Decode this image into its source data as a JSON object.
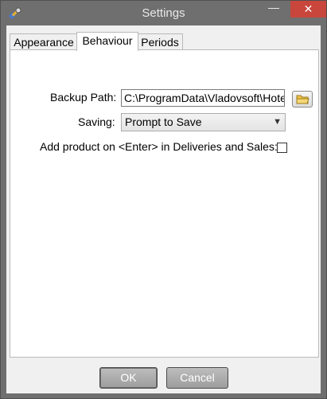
{
  "window": {
    "title": "Settings",
    "minimize_glyph": "—",
    "close_glyph": "✕"
  },
  "tabs": [
    {
      "label": "Appearance",
      "active": false
    },
    {
      "label": "Behaviour",
      "active": true
    },
    {
      "label": "Periods",
      "active": false
    }
  ],
  "behaviour": {
    "backup_path_label": "Backup Path:",
    "backup_path_value": "C:\\ProgramData\\Vladovsoft\\Hotel",
    "saving_label": "Saving:",
    "saving_value": "Prompt to Save",
    "add_product_label": "Add product on <Enter> in Deliveries and Sales:",
    "add_product_checked": false
  },
  "buttons": {
    "ok_label": "OK",
    "cancel_label": "Cancel"
  },
  "icons": {
    "app": "app-tools-icon",
    "browse": "folder-icon",
    "dropdown": "chevron-down-icon"
  },
  "colors": {
    "frame": "#6f6f6f",
    "close": "#c9463d",
    "client": "#f0f0f0",
    "panel": "#ffffff"
  }
}
